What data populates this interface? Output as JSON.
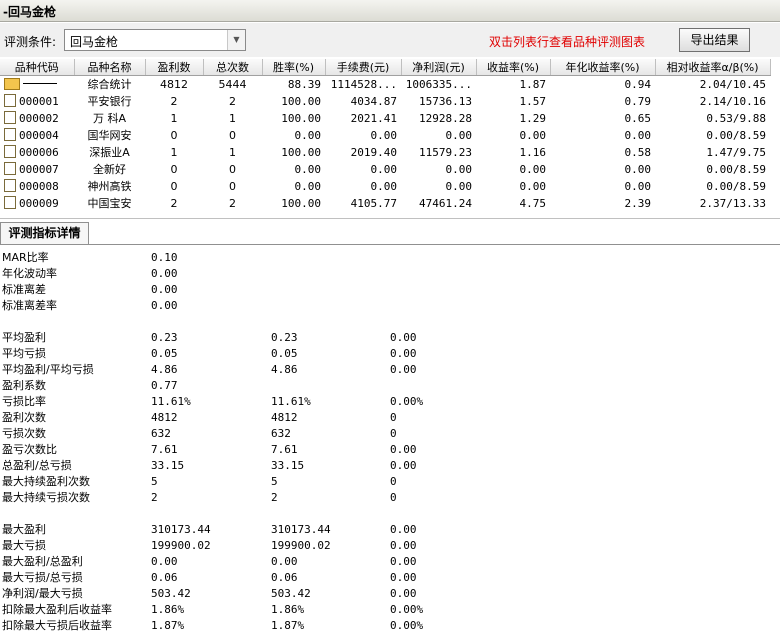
{
  "window": {
    "title": "-回马金枪"
  },
  "toolbar": {
    "condition_label": "评测条件:",
    "condition_value": "回马金枪",
    "hint": "双击列表行查看品种评测图表",
    "export_label": "导出结果"
  },
  "table": {
    "headers": [
      "品种代码",
      "品种名称",
      "盈利数",
      "总次数",
      "胜率(%)",
      "手续费(元)",
      "净利润(元)",
      "收益率(%)",
      "年化收益率(%)",
      "相对收益率α/β(%)"
    ],
    "rows": [
      {
        "code": "",
        "name": "综合统计",
        "profit_count": "4812",
        "total": "5444",
        "win_rate": "88.39",
        "fee": "1114528...",
        "net": "1006335...",
        "ret": "1.87",
        "annual": "0.94",
        "relative": "2.04/10.45"
      },
      {
        "code": "000001",
        "name": "平安银行",
        "profit_count": "2",
        "total": "2",
        "win_rate": "100.00",
        "fee": "4034.87",
        "net": "15736.13",
        "ret": "1.57",
        "annual": "0.79",
        "relative": "2.14/10.16"
      },
      {
        "code": "000002",
        "name": "万 科A",
        "profit_count": "1",
        "total": "1",
        "win_rate": "100.00",
        "fee": "2021.41",
        "net": "12928.28",
        "ret": "1.29",
        "annual": "0.65",
        "relative": "0.53/9.88"
      },
      {
        "code": "000004",
        "name": "国华网安",
        "profit_count": "0",
        "total": "0",
        "win_rate": "0.00",
        "fee": "0.00",
        "net": "0.00",
        "ret": "0.00",
        "annual": "0.00",
        "relative": "0.00/8.59"
      },
      {
        "code": "000006",
        "name": "深振业A",
        "profit_count": "1",
        "total": "1",
        "win_rate": "100.00",
        "fee": "2019.40",
        "net": "11579.23",
        "ret": "1.16",
        "annual": "0.58",
        "relative": "1.47/9.75"
      },
      {
        "code": "000007",
        "name": "全新好",
        "profit_count": "0",
        "total": "0",
        "win_rate": "0.00",
        "fee": "0.00",
        "net": "0.00",
        "ret": "0.00",
        "annual": "0.00",
        "relative": "0.00/8.59"
      },
      {
        "code": "000008",
        "name": "神州高铁",
        "profit_count": "0",
        "total": "0",
        "win_rate": "0.00",
        "fee": "0.00",
        "net": "0.00",
        "ret": "0.00",
        "annual": "0.00",
        "relative": "0.00/8.59"
      },
      {
        "code": "000009",
        "name": "中国宝安",
        "profit_count": "2",
        "total": "2",
        "win_rate": "100.00",
        "fee": "4105.77",
        "net": "47461.24",
        "ret": "4.75",
        "annual": "2.39",
        "relative": "2.37/13.33"
      }
    ]
  },
  "details": {
    "tab_label": "评测指标详情",
    "groups": [
      [
        {
          "name": "MAR比率",
          "v": [
            "0.10"
          ]
        },
        {
          "name": "年化波动率",
          "v": [
            "0.00"
          ]
        },
        {
          "name": "标准离差",
          "v": [
            "0.00"
          ]
        },
        {
          "name": "标准离差率",
          "v": [
            "0.00"
          ]
        }
      ],
      [
        {
          "name": "平均盈利",
          "v": [
            "0.23",
            "0.23",
            "0.00"
          ]
        },
        {
          "name": "平均亏损",
          "v": [
            "0.05",
            "0.05",
            "0.00"
          ]
        },
        {
          "name": "平均盈利/平均亏损",
          "v": [
            "4.86",
            "4.86",
            "0.00"
          ]
        },
        {
          "name": "盈利系数",
          "v": [
            "0.77"
          ]
        },
        {
          "name": "亏损比率",
          "v": [
            "11.61%",
            "11.61%",
            "0.00%"
          ]
        },
        {
          "name": "盈利次数",
          "v": [
            "4812",
            "4812",
            "0"
          ]
        },
        {
          "name": "亏损次数",
          "v": [
            "632",
            "632",
            "0"
          ]
        },
        {
          "name": "盈亏次数比",
          "v": [
            "7.61",
            "7.61",
            "0.00"
          ]
        },
        {
          "name": "总盈利/总亏损",
          "v": [
            "33.15",
            "33.15",
            "0.00"
          ]
        },
        {
          "name": "最大持续盈利次数",
          "v": [
            "5",
            "5",
            "0"
          ]
        },
        {
          "name": "最大持续亏损次数",
          "v": [
            "2",
            "2",
            "0"
          ]
        }
      ],
      [
        {
          "name": "最大盈利",
          "v": [
            "310173.44",
            "310173.44",
            "0.00"
          ]
        },
        {
          "name": "最大亏损",
          "v": [
            "199900.02",
            "199900.02",
            "0.00"
          ]
        },
        {
          "name": "最大盈利/总盈利",
          "v": [
            "0.00",
            "0.00",
            "0.00"
          ]
        },
        {
          "name": "最大亏损/总亏损",
          "v": [
            "0.06",
            "0.06",
            "0.00"
          ]
        },
        {
          "name": "净利润/最大亏损",
          "v": [
            "503.42",
            "503.42",
            "0.00"
          ]
        },
        {
          "name": "扣除最大盈利后收益率",
          "v": [
            "1.86%",
            "1.86%",
            "0.00%"
          ]
        },
        {
          "name": "扣除最大亏损后收益率",
          "v": [
            "1.87%",
            "1.87%",
            "0.00%"
          ]
        }
      ]
    ]
  }
}
